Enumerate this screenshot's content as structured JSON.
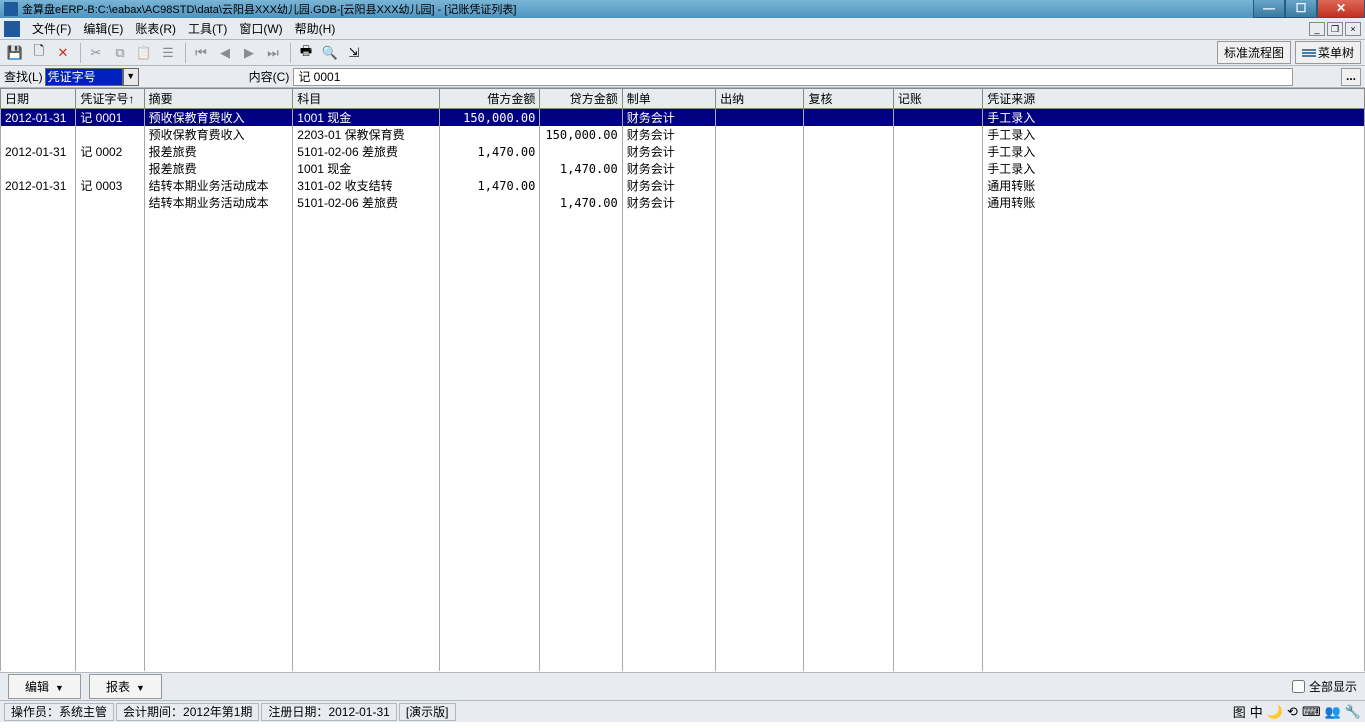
{
  "window": {
    "title": "金算盘eERP-B:C:\\eabax\\AC98STD\\data\\云阳县XXX幼儿园.GDB-[云阳县XXX幼儿园] - [记账凭证列表]"
  },
  "menubar": {
    "items": [
      "文件(F)",
      "编辑(E)",
      "账表(R)",
      "工具(T)",
      "窗口(W)",
      "帮助(H)"
    ]
  },
  "toolbar": {
    "std_process": "标准流程图",
    "menu_tree": "菜单树"
  },
  "searchbar": {
    "find_label": "查找(L)",
    "combo_value": "凭证字号",
    "content_label": "内容(C)",
    "content_value": "记 0001"
  },
  "grid": {
    "headers": [
      "日期",
      "凭证字号↑",
      "摘要",
      "科目",
      "借方金额",
      "贷方金额",
      "制单",
      "出纳",
      "复核",
      "记账",
      "凭证来源"
    ],
    "rows": [
      {
        "sel": true,
        "date": "2012-01-31",
        "vno": "记 0001",
        "summary": "预收保教育费收入",
        "subject": "1001 现金",
        "debit": "150,000.00",
        "credit": "",
        "maker": "财务会计",
        "source": "手工录入"
      },
      {
        "date": "",
        "vno": "",
        "summary": "预收保教育费收入",
        "subject": "2203-01 保教保育费",
        "debit": "",
        "credit": "150,000.00",
        "maker": "财务会计",
        "source": "手工录入"
      },
      {
        "date": "2012-01-31",
        "vno": "记 0002",
        "summary": "报差旅费",
        "subject": "5101-02-06 差旅费",
        "debit": "1,470.00",
        "credit": "",
        "maker": "财务会计",
        "source": "手工录入"
      },
      {
        "date": "",
        "vno": "",
        "summary": "报差旅费",
        "subject": "1001 现金",
        "debit": "",
        "credit": "1,470.00",
        "maker": "财务会计",
        "source": "手工录入"
      },
      {
        "date": "2012-01-31",
        "vno": "记 0003",
        "summary": "结转本期业务活动成本",
        "subject": "3101-02 收支结转",
        "debit": "1,470.00",
        "credit": "",
        "maker": "财务会计",
        "source": "通用转账"
      },
      {
        "date": "",
        "vno": "",
        "summary": "结转本期业务活动成本",
        "subject": "5101-02-06 差旅费",
        "debit": "",
        "credit": "1,470.00",
        "maker": "财务会计",
        "source": "通用转账"
      }
    ]
  },
  "footer": {
    "edit_btn": "编辑",
    "report_btn": "报表",
    "show_all": "全部显示"
  },
  "statusbar": {
    "operator_label": "操作员：",
    "operator": "系统主管",
    "period_label": "会计期间：",
    "period": "2012年第1期",
    "regdate_label": "注册日期：",
    "regdate": "2012-01-31",
    "demo": "[演示版]"
  }
}
